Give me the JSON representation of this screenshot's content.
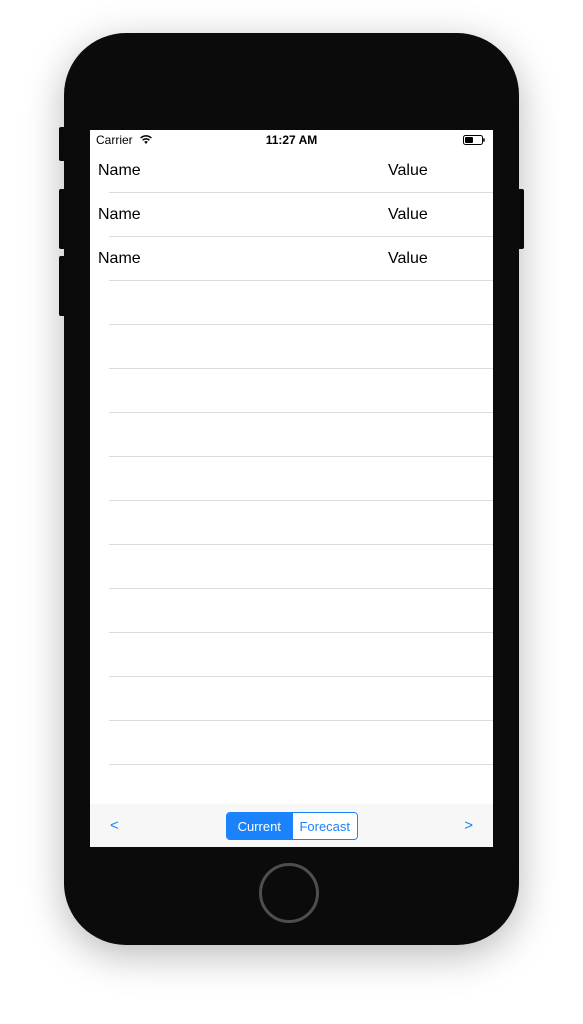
{
  "status_bar": {
    "carrier": "Carrier",
    "time": "11:27 AM"
  },
  "table": {
    "rows": [
      {
        "name": "Name",
        "value": "Value"
      },
      {
        "name": "Name",
        "value": "Value"
      },
      {
        "name": "Name",
        "value": "Value"
      }
    ]
  },
  "toolbar": {
    "prev_label": "<",
    "next_label": ">",
    "segments": [
      {
        "label": "Current",
        "selected": true
      },
      {
        "label": "Forecast",
        "selected": false
      }
    ]
  },
  "colors": {
    "accent": "#1a82fb",
    "phone_body": "#0b0b0b",
    "separator": "#dcdcdc",
    "toolbar_bg": "#f7f7f7"
  },
  "icons": {
    "wifi": "wifi-icon",
    "battery": "battery-icon"
  }
}
